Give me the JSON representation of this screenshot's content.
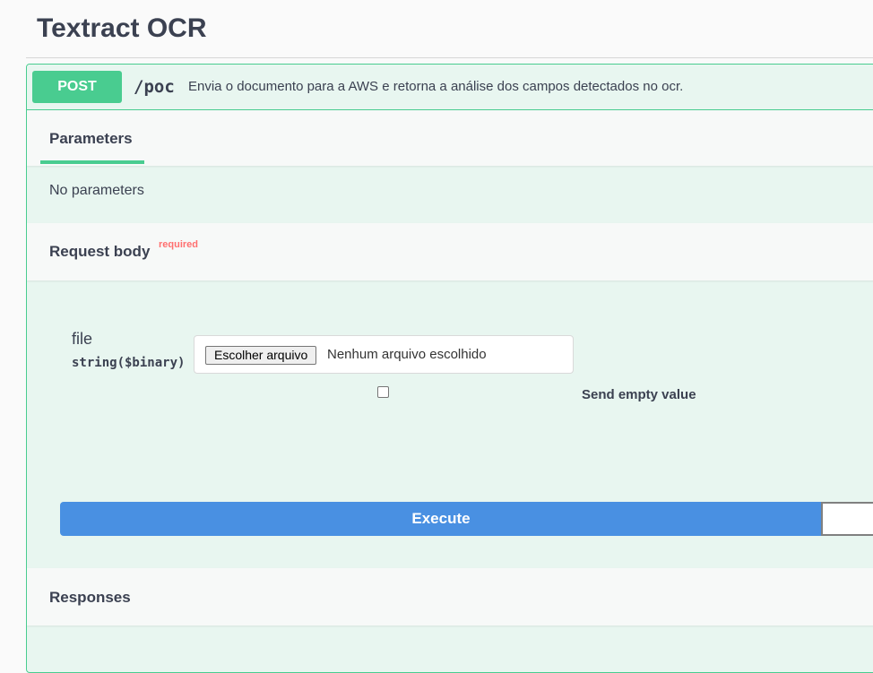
{
  "page": {
    "title": "Textract OCR"
  },
  "operation": {
    "method": "POST",
    "path": "/poc",
    "description": "Envia o documento para a AWS e retorna a análise dos campos detectados no ocr.",
    "accent_color": "#49cc90"
  },
  "parameters": {
    "tab_label": "Parameters",
    "empty_text": "No parameters"
  },
  "request_body": {
    "title": "Request body",
    "required_label": "required",
    "field": {
      "name": "file",
      "type": "string",
      "format": "($binary)",
      "choose_button_label": "Escolher arquivo",
      "status_text": "Nenhum arquivo escolhido"
    },
    "send_empty": {
      "label": "Send empty value",
      "checked": false
    }
  },
  "actions": {
    "execute_label": "Execute",
    "execute_color": "#4990e2"
  },
  "responses": {
    "title": "Responses"
  }
}
